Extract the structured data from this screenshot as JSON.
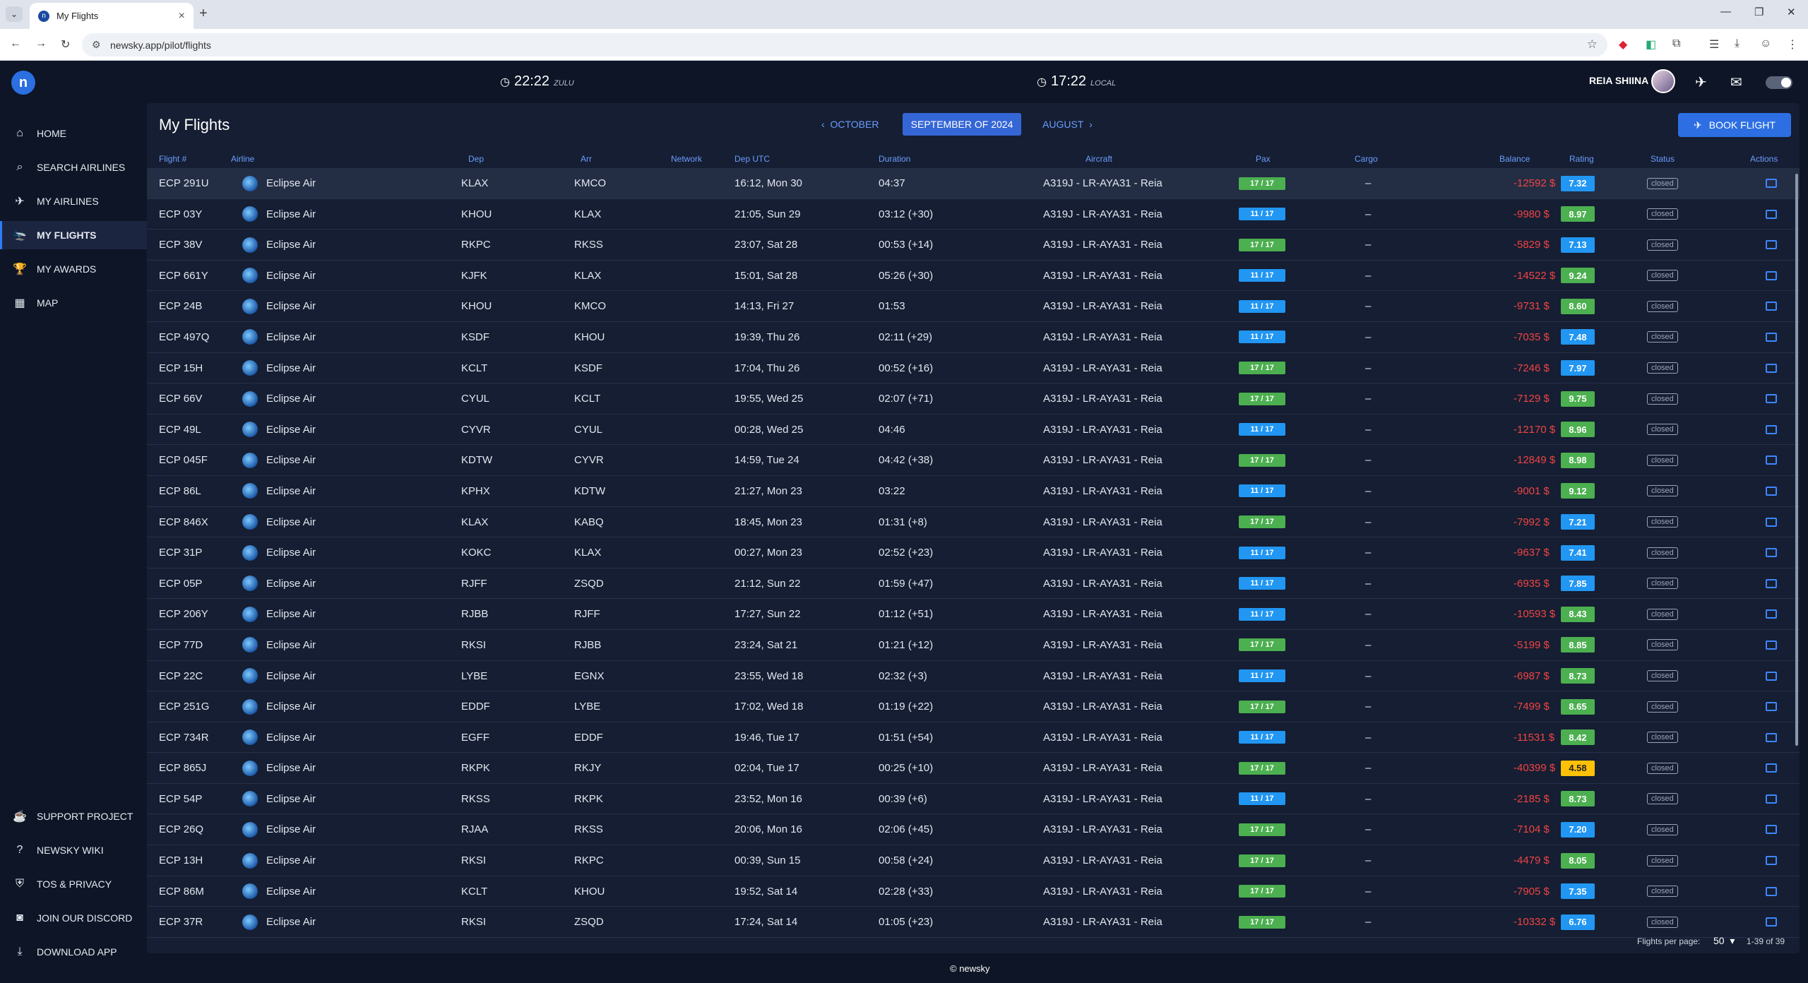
{
  "browser": {
    "tab_title": "My Flights",
    "url": "newsky.app/pilot/flights"
  },
  "header": {
    "zulu_time": "22:22",
    "zulu_label": "ZULU",
    "local_time": "17:22",
    "local_label": "LOCAL",
    "user_name": "REIA SHIINA",
    "icons": [
      "plane-icon",
      "mail-icon",
      "theme-toggle"
    ]
  },
  "sidebar": {
    "items": [
      {
        "label": "HOME",
        "icon": "home-icon"
      },
      {
        "label": "SEARCH AIRLINES",
        "icon": "search-icon"
      },
      {
        "label": "MY AIRLINES",
        "icon": "airline-icon"
      },
      {
        "label": "MY FLIGHTS",
        "icon": "plane-landing-icon",
        "active": true
      },
      {
        "label": "MY AWARDS",
        "icon": "trophy-icon"
      },
      {
        "label": "MAP",
        "icon": "map-icon"
      }
    ],
    "bottom_items": [
      {
        "label": "SUPPORT PROJECT",
        "icon": "coffee-icon"
      },
      {
        "label": "NEWSKY WIKI",
        "icon": "help-icon"
      },
      {
        "label": "TOS & PRIVACY",
        "icon": "shield-icon"
      },
      {
        "label": "JOIN OUR DISCORD",
        "icon": "discord-icon"
      },
      {
        "label": "DOWNLOAD APP",
        "icon": "download-icon"
      }
    ]
  },
  "main": {
    "title": "My Flights",
    "prev_month": "OCTOBER",
    "current_month": "SEPTEMBER OF 2024",
    "next_month": "AUGUST",
    "book_button": "BOOK FLIGHT",
    "columns": [
      "Flight #",
      "Airline",
      "Dep",
      "Arr",
      "Network",
      "Dep UTC",
      "Duration",
      "Aircraft",
      "Pax",
      "Cargo",
      "Balance",
      "Rating",
      "Status",
      "Actions"
    ],
    "rows": [
      {
        "flight": "ECP 291U",
        "airline": "Eclipse Air",
        "dep": "KLAX",
        "arr": "KMCO",
        "dep_utc": "16:12, Mon 30",
        "duration": "04:37",
        "aircraft": "A319J - LR-AYA31 - Reia",
        "pax": "17 / 17",
        "pax_color": "green",
        "cargo": "–",
        "balance": "-12592 $",
        "rating": "7.32",
        "rating_color": "blue",
        "status": "closed"
      },
      {
        "flight": "ECP 03Y",
        "airline": "Eclipse Air",
        "dep": "KHOU",
        "arr": "KLAX",
        "dep_utc": "21:05, Sun 29",
        "duration": "03:12 (+30)",
        "aircraft": "A319J - LR-AYA31 - Reia",
        "pax": "11 / 17",
        "pax_color": "blue",
        "cargo": "–",
        "balance": "-9980 $",
        "rating": "8.97",
        "rating_color": "green",
        "status": "closed"
      },
      {
        "flight": "ECP 38V",
        "airline": "Eclipse Air",
        "dep": "RKPC",
        "arr": "RKSS",
        "dep_utc": "23:07, Sat 28",
        "duration": "00:53 (+14)",
        "aircraft": "A319J - LR-AYA31 - Reia",
        "pax": "17 / 17",
        "pax_color": "green",
        "cargo": "–",
        "balance": "-5829 $",
        "rating": "7.13",
        "rating_color": "blue",
        "status": "closed"
      },
      {
        "flight": "ECP 661Y",
        "airline": "Eclipse Air",
        "dep": "KJFK",
        "arr": "KLAX",
        "dep_utc": "15:01, Sat 28",
        "duration": "05:26 (+30)",
        "aircraft": "A319J - LR-AYA31 - Reia",
        "pax": "11 / 17",
        "pax_color": "blue",
        "cargo": "–",
        "balance": "-14522 $",
        "rating": "9.24",
        "rating_color": "green",
        "status": "closed"
      },
      {
        "flight": "ECP 24B",
        "airline": "Eclipse Air",
        "dep": "KHOU",
        "arr": "KMCO",
        "dep_utc": "14:13, Fri 27",
        "duration": "01:53",
        "aircraft": "A319J - LR-AYA31 - Reia",
        "pax": "11 / 17",
        "pax_color": "blue",
        "cargo": "–",
        "balance": "-9731 $",
        "rating": "8.60",
        "rating_color": "green",
        "status": "closed"
      },
      {
        "flight": "ECP 497Q",
        "airline": "Eclipse Air",
        "dep": "KSDF",
        "arr": "KHOU",
        "dep_utc": "19:39, Thu 26",
        "duration": "02:11 (+29)",
        "aircraft": "A319J - LR-AYA31 - Reia",
        "pax": "11 / 17",
        "pax_color": "blue",
        "cargo": "–",
        "balance": "-7035 $",
        "rating": "7.48",
        "rating_color": "blue",
        "status": "closed"
      },
      {
        "flight": "ECP 15H",
        "airline": "Eclipse Air",
        "dep": "KCLT",
        "arr": "KSDF",
        "dep_utc": "17:04, Thu 26",
        "duration": "00:52 (+16)",
        "aircraft": "A319J - LR-AYA31 - Reia",
        "pax": "17 / 17",
        "pax_color": "green",
        "cargo": "–",
        "balance": "-7246 $",
        "rating": "7.97",
        "rating_color": "blue",
        "status": "closed"
      },
      {
        "flight": "ECP 66V",
        "airline": "Eclipse Air",
        "dep": "CYUL",
        "arr": "KCLT",
        "dep_utc": "19:55, Wed 25",
        "duration": "02:07 (+71)",
        "aircraft": "A319J - LR-AYA31 - Reia",
        "pax": "17 / 17",
        "pax_color": "green",
        "cargo": "–",
        "balance": "-7129 $",
        "rating": "9.75",
        "rating_color": "green",
        "status": "closed"
      },
      {
        "flight": "ECP 49L",
        "airline": "Eclipse Air",
        "dep": "CYVR",
        "arr": "CYUL",
        "dep_utc": "00:28, Wed 25",
        "duration": "04:46",
        "aircraft": "A319J - LR-AYA31 - Reia",
        "pax": "11 / 17",
        "pax_color": "blue",
        "cargo": "–",
        "balance": "-12170 $",
        "rating": "8.96",
        "rating_color": "green",
        "status": "closed"
      },
      {
        "flight": "ECP 045F",
        "airline": "Eclipse Air",
        "dep": "KDTW",
        "arr": "CYVR",
        "dep_utc": "14:59, Tue 24",
        "duration": "04:42 (+38)",
        "aircraft": "A319J - LR-AYA31 - Reia",
        "pax": "17 / 17",
        "pax_color": "green",
        "cargo": "–",
        "balance": "-12849 $",
        "rating": "8.98",
        "rating_color": "green",
        "status": "closed"
      },
      {
        "flight": "ECP 86L",
        "airline": "Eclipse Air",
        "dep": "KPHX",
        "arr": "KDTW",
        "dep_utc": "21:27, Mon 23",
        "duration": "03:22",
        "aircraft": "A319J - LR-AYA31 - Reia",
        "pax": "11 / 17",
        "pax_color": "blue",
        "cargo": "–",
        "balance": "-9001 $",
        "rating": "9.12",
        "rating_color": "green",
        "status": "closed"
      },
      {
        "flight": "ECP 846X",
        "airline": "Eclipse Air",
        "dep": "KLAX",
        "arr": "KABQ",
        "dep_utc": "18:45, Mon 23",
        "duration": "01:31 (+8)",
        "aircraft": "A319J - LR-AYA31 - Reia",
        "pax": "17 / 17",
        "pax_color": "green",
        "cargo": "–",
        "balance": "-7992 $",
        "rating": "7.21",
        "rating_color": "blue",
        "status": "closed"
      },
      {
        "flight": "ECP 31P",
        "airline": "Eclipse Air",
        "dep": "KOKC",
        "arr": "KLAX",
        "dep_utc": "00:27, Mon 23",
        "duration": "02:52 (+23)",
        "aircraft": "A319J - LR-AYA31 - Reia",
        "pax": "11 / 17",
        "pax_color": "blue",
        "cargo": "–",
        "balance": "-9637 $",
        "rating": "7.41",
        "rating_color": "blue",
        "status": "closed"
      },
      {
        "flight": "ECP 05P",
        "airline": "Eclipse Air",
        "dep": "RJFF",
        "arr": "ZSQD",
        "dep_utc": "21:12, Sun 22",
        "duration": "01:59 (+47)",
        "aircraft": "A319J - LR-AYA31 - Reia",
        "pax": "11 / 17",
        "pax_color": "blue",
        "cargo": "–",
        "balance": "-6935 $",
        "rating": "7.85",
        "rating_color": "blue",
        "status": "closed"
      },
      {
        "flight": "ECP 206Y",
        "airline": "Eclipse Air",
        "dep": "RJBB",
        "arr": "RJFF",
        "dep_utc": "17:27, Sun 22",
        "duration": "01:12 (+51)",
        "aircraft": "A319J - LR-AYA31 - Reia",
        "pax": "11 / 17",
        "pax_color": "blue",
        "cargo": "–",
        "balance": "-10593 $",
        "rating": "8.43",
        "rating_color": "green",
        "status": "closed"
      },
      {
        "flight": "ECP 77D",
        "airline": "Eclipse Air",
        "dep": "RKSI",
        "arr": "RJBB",
        "dep_utc": "23:24, Sat 21",
        "duration": "01:21 (+12)",
        "aircraft": "A319J - LR-AYA31 - Reia",
        "pax": "17 / 17",
        "pax_color": "green",
        "cargo": "–",
        "balance": "-5199 $",
        "rating": "8.85",
        "rating_color": "green",
        "status": "closed"
      },
      {
        "flight": "ECP 22C",
        "airline": "Eclipse Air",
        "dep": "LYBE",
        "arr": "EGNX",
        "dep_utc": "23:55, Wed 18",
        "duration": "02:32 (+3)",
        "aircraft": "A319J - LR-AYA31 - Reia",
        "pax": "11 / 17",
        "pax_color": "blue",
        "cargo": "–",
        "balance": "-6987 $",
        "rating": "8.73",
        "rating_color": "green",
        "status": "closed"
      },
      {
        "flight": "ECP 251G",
        "airline": "Eclipse Air",
        "dep": "EDDF",
        "arr": "LYBE",
        "dep_utc": "17:02, Wed 18",
        "duration": "01:19 (+22)",
        "aircraft": "A319J - LR-AYA31 - Reia",
        "pax": "17 / 17",
        "pax_color": "green",
        "cargo": "–",
        "balance": "-7499 $",
        "rating": "8.65",
        "rating_color": "green",
        "status": "closed"
      },
      {
        "flight": "ECP 734R",
        "airline": "Eclipse Air",
        "dep": "EGFF",
        "arr": "EDDF",
        "dep_utc": "19:46, Tue 17",
        "duration": "01:51 (+54)",
        "aircraft": "A319J - LR-AYA31 - Reia",
        "pax": "11 / 17",
        "pax_color": "blue",
        "cargo": "–",
        "balance": "-11531 $",
        "rating": "8.42",
        "rating_color": "green",
        "status": "closed"
      },
      {
        "flight": "ECP 865J",
        "airline": "Eclipse Air",
        "dep": "RKPK",
        "arr": "RKJY",
        "dep_utc": "02:04, Tue 17",
        "duration": "00:25 (+10)",
        "aircraft": "A319J - LR-AYA31 - Reia",
        "pax": "17 / 17",
        "pax_color": "green",
        "cargo": "–",
        "balance": "-40399 $",
        "rating": "4.58",
        "rating_color": "yellow",
        "status": "closed"
      },
      {
        "flight": "ECP 54P",
        "airline": "Eclipse Air",
        "dep": "RKSS",
        "arr": "RKPK",
        "dep_utc": "23:52, Mon 16",
        "duration": "00:39 (+6)",
        "aircraft": "A319J - LR-AYA31 - Reia",
        "pax": "11 / 17",
        "pax_color": "blue",
        "cargo": "–",
        "balance": "-2185 $",
        "rating": "8.73",
        "rating_color": "green",
        "status": "closed"
      },
      {
        "flight": "ECP 26Q",
        "airline": "Eclipse Air",
        "dep": "RJAA",
        "arr": "RKSS",
        "dep_utc": "20:06, Mon 16",
        "duration": "02:06 (+45)",
        "aircraft": "A319J - LR-AYA31 - Reia",
        "pax": "17 / 17",
        "pax_color": "green",
        "cargo": "–",
        "balance": "-7104 $",
        "rating": "7.20",
        "rating_color": "blue",
        "status": "closed"
      },
      {
        "flight": "ECP 13H",
        "airline": "Eclipse Air",
        "dep": "RKSI",
        "arr": "RKPC",
        "dep_utc": "00:39, Sun 15",
        "duration": "00:58 (+24)",
        "aircraft": "A319J - LR-AYA31 - Reia",
        "pax": "17 / 17",
        "pax_color": "green",
        "cargo": "–",
        "balance": "-4479 $",
        "rating": "8.05",
        "rating_color": "green",
        "status": "closed"
      },
      {
        "flight": "ECP 86M",
        "airline": "Eclipse Air",
        "dep": "KCLT",
        "arr": "KHOU",
        "dep_utc": "19:52, Sat 14",
        "duration": "02:28 (+33)",
        "aircraft": "A319J - LR-AYA31 - Reia",
        "pax": "17 / 17",
        "pax_color": "green",
        "cargo": "–",
        "balance": "-7905 $",
        "rating": "7.35",
        "rating_color": "blue",
        "status": "closed"
      },
      {
        "flight": "ECP 37R",
        "airline": "Eclipse Air",
        "dep": "RKSI",
        "arr": "ZSQD",
        "dep_utc": "17:24, Sat 14",
        "duration": "01:05 (+23)",
        "aircraft": "A319J - LR-AYA31 - Reia",
        "pax": "17 / 17",
        "pax_color": "green",
        "cargo": "–",
        "balance": "-10332 $",
        "rating": "6.76",
        "rating_color": "blue",
        "status": "closed"
      }
    ],
    "pagination": {
      "per_page_label": "Flights per page:",
      "per_page": "50",
      "range": "1-39 of 39"
    }
  },
  "footer": {
    "copyright": "© newsky"
  }
}
